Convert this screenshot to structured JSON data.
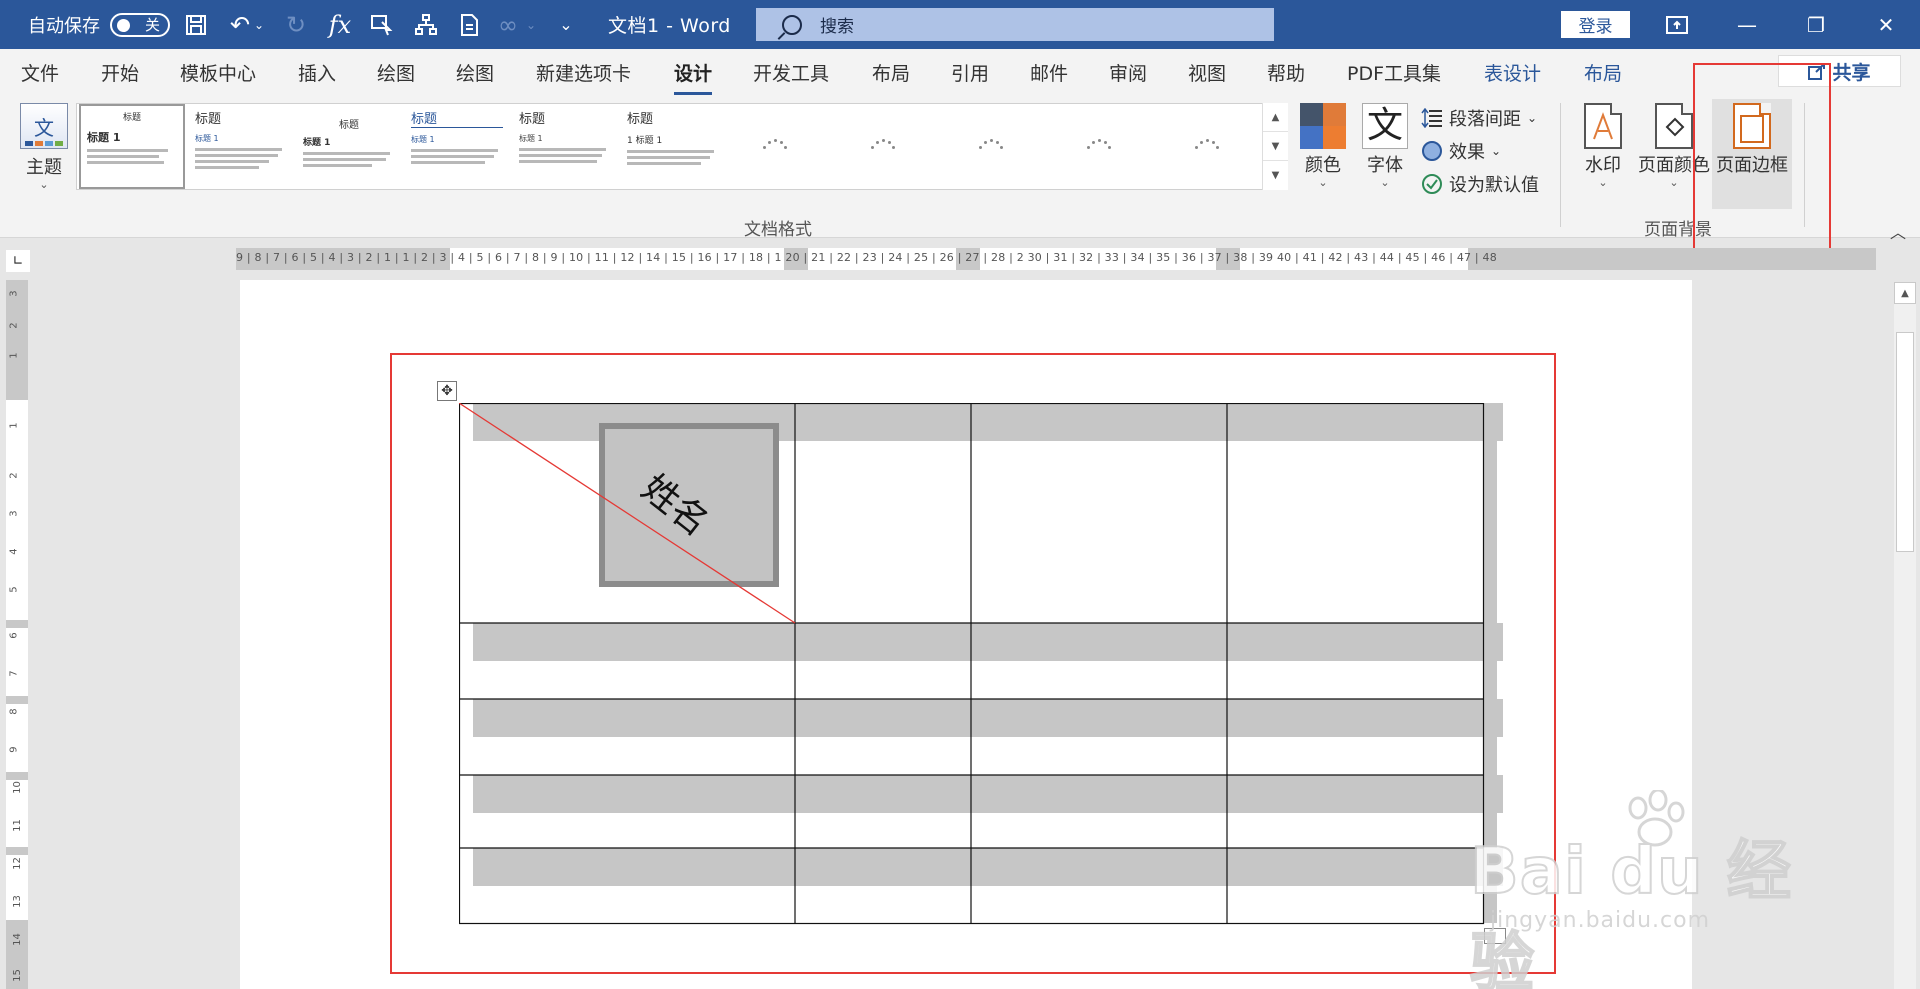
{
  "titlebar": {
    "autosave_label": "自动保存",
    "autosave_state": "关",
    "doc_title": "文档1  -  Word",
    "search_placeholder": "搜索",
    "login_label": "登录",
    "qa_icons": [
      "save-icon",
      "undo-icon",
      "redo-icon",
      "function-icon",
      "touch-mode-icon",
      "org-chart-icon",
      "document-icon",
      "link-icon",
      "customize-icon"
    ]
  },
  "tabs": [
    "文件",
    "开始",
    "模板中心",
    "插入",
    "绘图",
    "绘图",
    "新建选项卡",
    "设计",
    "开发工具",
    "布局",
    "引用",
    "邮件",
    "审阅",
    "视图",
    "帮助",
    "PDF工具集",
    "表设计",
    "布局"
  ],
  "active_tab": "设计",
  "share_label": "共享",
  "ribbon": {
    "theme_label": "主题",
    "gallery": [
      {
        "title": "标题",
        "heading": "标题 1"
      },
      {
        "title": "标题",
        "heading": "标题 1"
      },
      {
        "title": "标题",
        "heading": "标题 1"
      },
      {
        "title": "标题",
        "heading": "标题 1"
      },
      {
        "title": "标题",
        "heading": "标题 1"
      },
      {
        "title": "标题",
        "heading": "1  标题 1"
      }
    ],
    "doc_format_label": "文档格式",
    "colors_label": "颜色",
    "fonts_label": "字体",
    "font_glyph": "文",
    "paragraph_spacing_label": "段落间距",
    "effects_label": "效果",
    "set_default_label": "设为默认值",
    "watermark_label": "水印",
    "page_color_label": "页面颜色",
    "page_borders_label": "页面边框",
    "page_background_label": "页面背景"
  },
  "ruler": {
    "horizontal_text": "9 | 8 | 7 | 6 | 5 | 4 | 3 | 2 | 1     | 1 | 2 | 3 | 4 | 5 | 6 | 7 | 8 | 9 | 10 | 11 | 12     | 14 | 15 | 16 | 17 | 18 | 1     20 | 21 | 22 | 23 | 24 | 25 | 26 | 27 | 28 | 2     30 | 31 | 32 | 33 | 34 | 35 | 36 | 37 | 38 | 39     40 | 41 | 42 | 43 | 44 | 45 | 46 | 47 | 48",
    "vertical_numbers": [
      "3",
      "2",
      "1",
      "1",
      "1",
      "2",
      "3",
      "4",
      "5",
      "6",
      "7",
      "8",
      "9",
      "10",
      "11",
      "12",
      "13",
      "14",
      "15"
    ]
  },
  "document": {
    "diagonal_cell_text": "姓名"
  },
  "watermark": {
    "brand": "Bai du 经验",
    "url": "jingyan.baidu.com"
  },
  "colors": {
    "title_bar": "#2b579a",
    "highlight_box": "#e53935",
    "diagonal_line": "#e53935"
  }
}
